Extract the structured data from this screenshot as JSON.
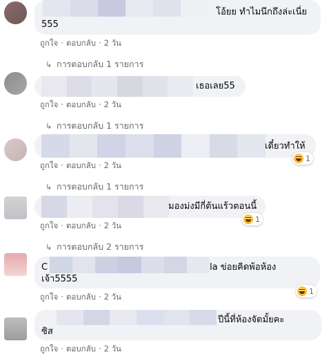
{
  "colors": {
    "bubble_bg": "#f0f2f5",
    "meta_text": "#65676b",
    "reaction_emoji": "haha-emoji"
  },
  "comments": [
    {
      "text_line1": "โอ้ยย ทำไมนึกถึงล่ะเนี่ย",
      "text_line2": "555",
      "like": "ถูกใจ",
      "sep": "·",
      "reply_label": "ตอบกลับ",
      "time": "2 วัน",
      "replies": "การตอบกลับ 1 รายการ"
    },
    {
      "text_line1": "เธอเลย55",
      "like": "ถูกใจ",
      "sep": "·",
      "reply_label": "ตอบกลับ",
      "time": "2 วัน",
      "replies": "การตอบกลับ 1 รายการ"
    },
    {
      "text_line1": "เดี๋ยวทำให้",
      "reaction_count": "1",
      "like": "ถูกใจ",
      "sep": "·",
      "reply_label": "ตอบกลับ",
      "time": "2 วัน",
      "replies": "การตอบกลับ 1 รายการ"
    },
    {
      "text_line1": "มองม่งมีกี่ต้นแร้วตอนนี้",
      "reaction_count": "1",
      "like": "ถูกใจ",
      "sep": "·",
      "reply_label": "ตอบกลับ",
      "time": "2 วัน",
      "replies": "การตอบกลับ 2 รายการ"
    },
    {
      "text_line1_prefix": "C",
      "text_line1": "la ข่อยคิดพ้อห้อง",
      "text_line2": "เจ้า5555",
      "reaction_count": "1",
      "like": "ถูกใจ",
      "sep": "·",
      "reply_label": "ตอบกลับ",
      "time": "2 วัน"
    },
    {
      "text_line1": "ปีนี้ที่ห้องจัดมั้ยคะ",
      "text_line2": "ซิส",
      "like": "ถูกใจ",
      "sep": "·",
      "reply_label": "ตอบกลับ",
      "time": "2 วัน"
    }
  ]
}
